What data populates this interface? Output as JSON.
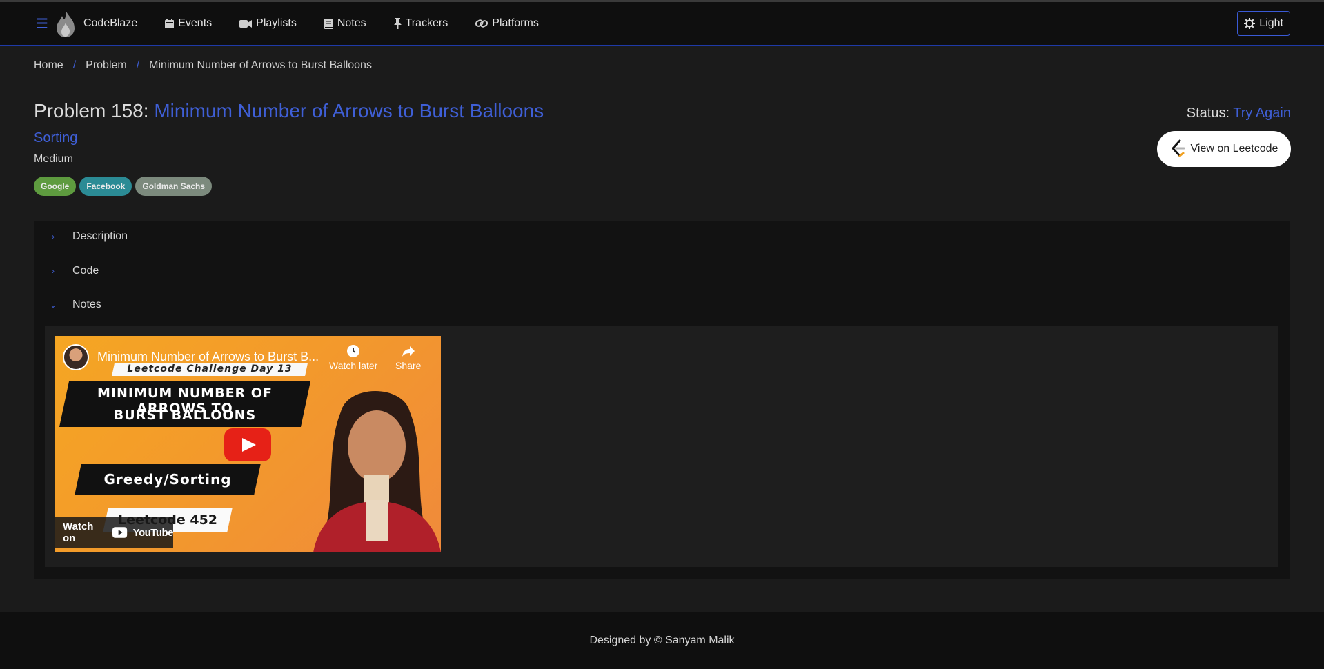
{
  "nav": {
    "brand": "CodeBlaze",
    "items": [
      {
        "label": "Events",
        "icon": "calendar-icon"
      },
      {
        "label": "Playlists",
        "icon": "video-camera-icon"
      },
      {
        "label": "Notes",
        "icon": "book-icon"
      },
      {
        "label": "Trackers",
        "icon": "pin-icon"
      },
      {
        "label": "Platforms",
        "icon": "link-icon"
      }
    ],
    "theme_label": "Light"
  },
  "breadcrumb": [
    "Home",
    "Problem",
    "Minimum Number of Arrows to Burst Balloons"
  ],
  "problem": {
    "title_prefix": "Problem 158: ",
    "name": "Minimum Number of Arrows to Burst Balloons",
    "topic": "Sorting",
    "difficulty": "Medium",
    "tags": [
      {
        "label": "Google",
        "color": "#5e9b3f"
      },
      {
        "label": "Facebook",
        "color": "#2b8b95"
      },
      {
        "label": "Goldman Sachs",
        "color": "#7c8a7d"
      }
    ],
    "status_label": "Status:",
    "status_value": "Try Again",
    "leetcode_button": "View on Leetcode"
  },
  "accordion": {
    "sections": [
      "Description",
      "Code",
      "Notes"
    ]
  },
  "video": {
    "title": "Minimum Number of Arrows to Burst B...",
    "watch_later": "Watch later",
    "share": "Share",
    "thumb_line1": "Leetcode Challenge Day 13",
    "thumb_line2": "MINIMUM NUMBER OF ARROWS TO",
    "thumb_line3": "BURST BALLOONS",
    "thumb_line4": "Greedy/Sorting",
    "thumb_line5": "Leetcode 452",
    "watch_on": "Watch on",
    "youtube": "YouTube"
  },
  "footer": {
    "text": "Designed by © Sanyam Malik"
  },
  "colors": {
    "accent": "#3f5fd6",
    "background": "#1b1b1b",
    "navbar": "#0f0f0f"
  }
}
